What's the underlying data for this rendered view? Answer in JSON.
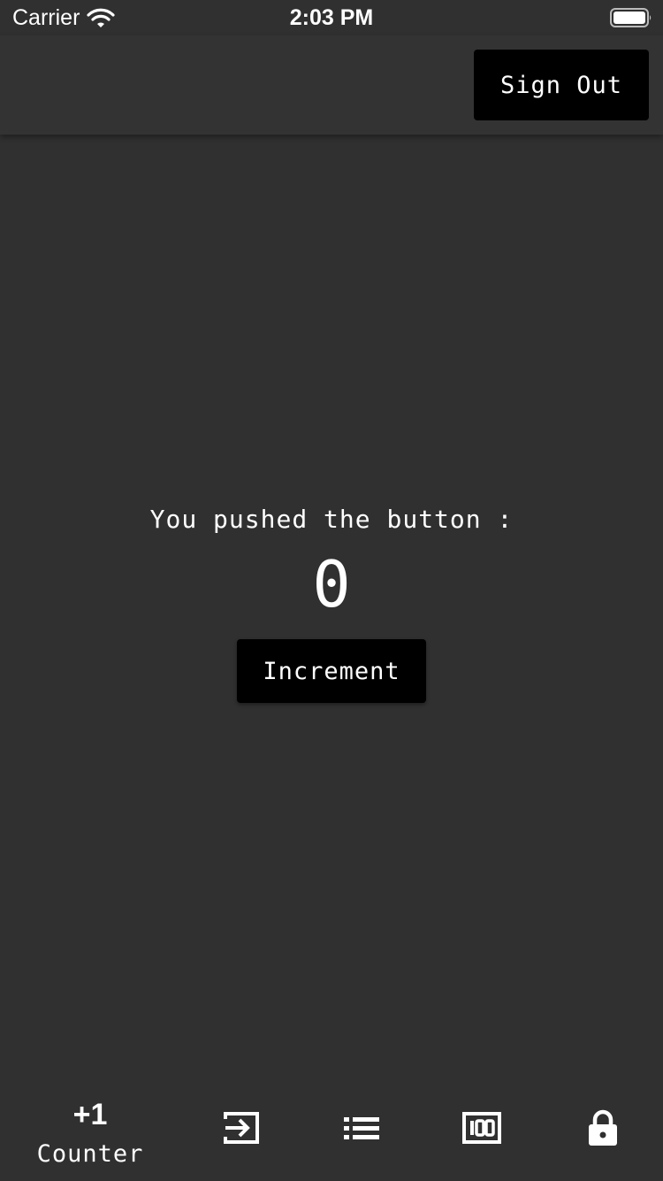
{
  "status_bar": {
    "carrier": "Carrier",
    "time": "2:03 PM",
    "icons": [
      "wifi-icon",
      "battery-icon"
    ]
  },
  "app_bar": {
    "sign_out_label": "Sign Out"
  },
  "main": {
    "prompt": "You pushed the button :",
    "counter_value": "0",
    "increment_label": "Increment"
  },
  "bottom_nav": {
    "items": [
      {
        "icon": "plus-one-icon",
        "icon_text": "+1",
        "label": "Counter",
        "selected": true
      },
      {
        "icon": "login-icon",
        "label": ""
      },
      {
        "icon": "list-icon",
        "label": ""
      },
      {
        "icon": "scoreboard-100-icon",
        "label": ""
      },
      {
        "icon": "lock-icon",
        "label": ""
      }
    ]
  },
  "colors": {
    "background": "#303030",
    "app_bar": "#333333",
    "button": "#000000",
    "text": "#ffffff"
  }
}
